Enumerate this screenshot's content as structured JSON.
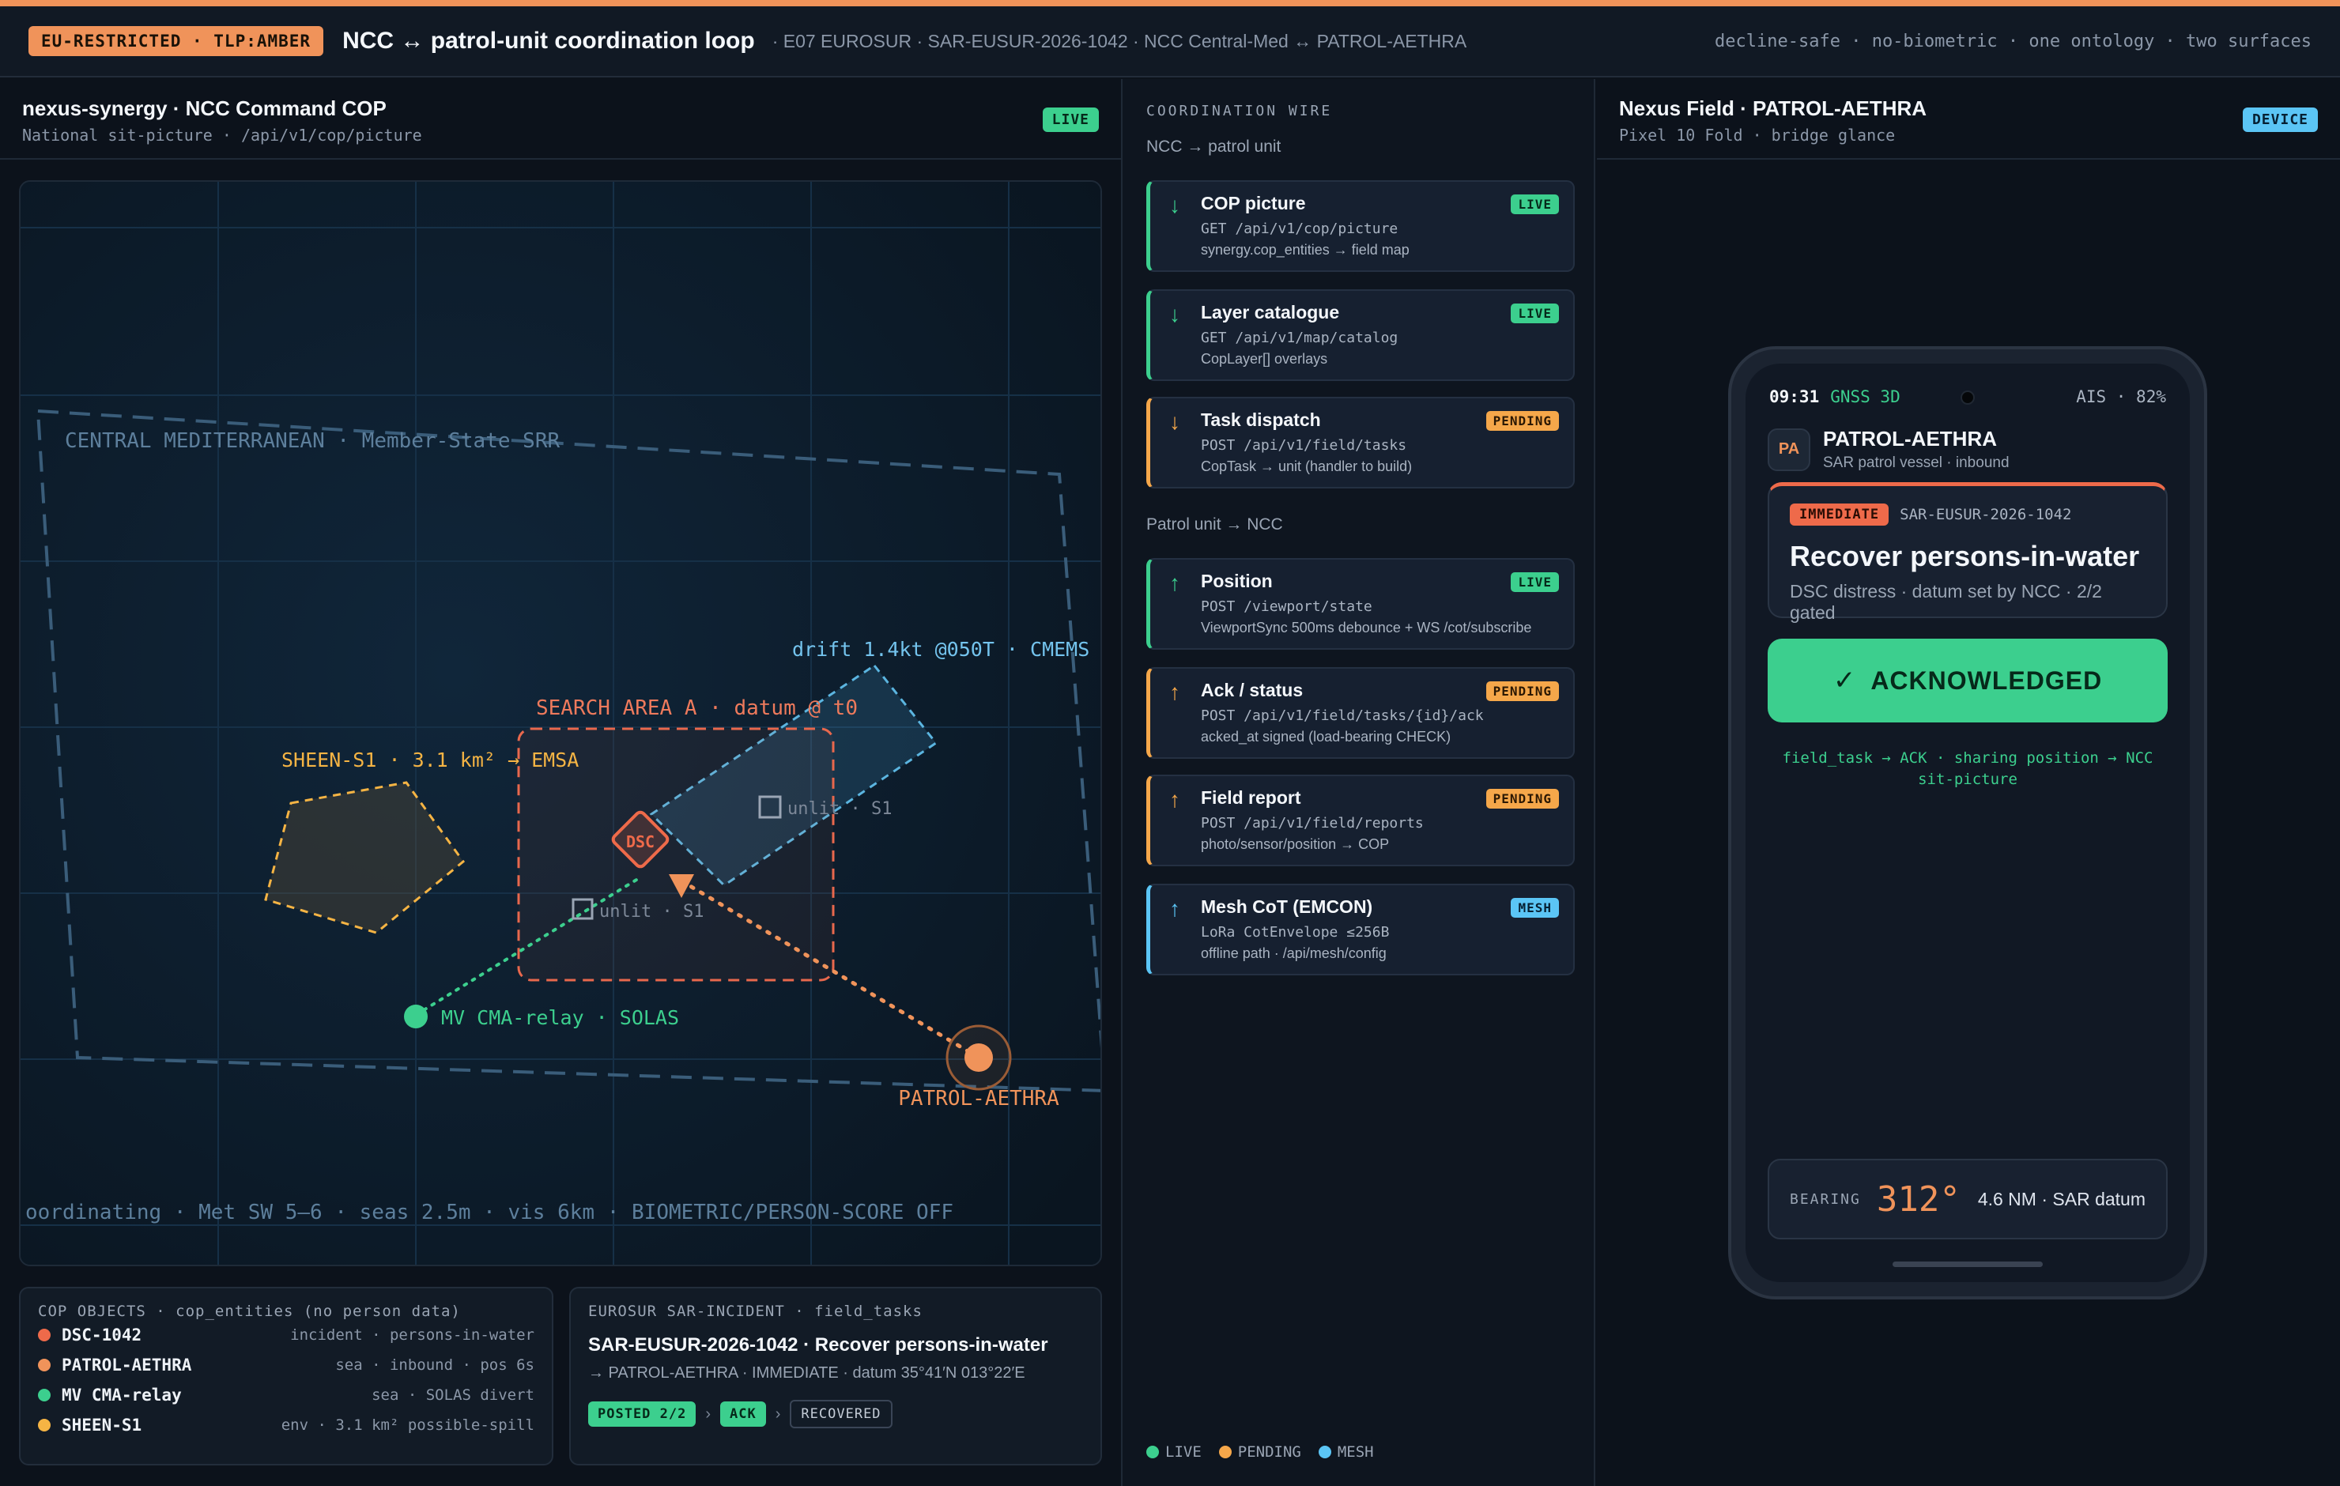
{
  "topbar": {
    "classification": "EU-RESTRICTED · TLP:AMBER",
    "title": "NCC ↔ patrol-unit coordination loop",
    "subtitle": "· E07 EUROSUR · SAR-EUSUR-2026-1042 · NCC Central-Med ↔ PATROL-AETHRA",
    "tags": "decline-safe · no-biometric · one ontology · two surfaces"
  },
  "cop": {
    "title": "nexus-synergy · NCC Command COP",
    "subtitle": "National sit-picture · /api/v1/cop/picture",
    "badge": "LIVE",
    "map": {
      "region_label": "CENTRAL MEDITERRANEAN · Member-State SRR",
      "drift_label": "drift 1.4kt @050T · CMEMS leeway",
      "search_label": "SEARCH AREA A · datum @ t0",
      "sheen_label": "SHEEN-S1 · 3.1 km² → EMSA",
      "dsc_label": "DSC",
      "unlit_1": "unlit · S1",
      "unlit_2": "unlit · S1",
      "relay_label": "MV CMA-relay · SOLAS",
      "patrol_label": "PATROL-AETHRA",
      "footer": "oordinating · Met SW 5–6 · seas 2.5m · vis 6km · BIOMETRIC/PERSON-SCORE OFF"
    }
  },
  "objects": {
    "header": "COP OBJECTS · cop_entities (no person data)",
    "items": [
      {
        "name": "DSC-1042",
        "meta": "incident · persons-in-water",
        "color": "#ee6a4a"
      },
      {
        "name": "PATROL-AETHRA",
        "meta": "sea · inbound · pos 6s",
        "color": "#f0935a"
      },
      {
        "name": "MV CMA-relay",
        "meta": "sea · SOLAS divert",
        "color": "#3ccf8e"
      },
      {
        "name": "SHEEN-S1",
        "meta": "env · 3.1 km² possible-spill",
        "color": "#f5b444"
      }
    ]
  },
  "incident": {
    "header": "EUROSUR SAR-INCIDENT · field_tasks",
    "title": "SAR-EUSUR-2026-1042 · Recover persons-in-water",
    "desc": "→ PATROL-AETHRA · IMMEDIATE · datum 35°41′N 013°22′E",
    "steps": [
      "POSTED 2/2",
      "ACK",
      "RECOVERED"
    ],
    "step_arrow": "›"
  },
  "wire": {
    "title": "COORDINATION WIRE",
    "group_down": "NCC → patrol unit",
    "group_up": "Patrol unit → NCC",
    "arrow_down": "↓",
    "arrow_up": "↑",
    "cards": [
      {
        "name": "COP picture",
        "endpoint": "GET /api/v1/cop/picture",
        "desc": "synergy.cop_entities → field map",
        "status": "LIVE"
      },
      {
        "name": "Layer catalogue",
        "endpoint": "GET /api/v1/map/catalog",
        "desc": "CopLayer[] overlays",
        "status": "LIVE"
      },
      {
        "name": "Task dispatch",
        "endpoint": "POST /api/v1/field/tasks",
        "desc": "CopTask → unit (handler to build)",
        "status": "PENDING"
      },
      {
        "name": "Position",
        "endpoint": "POST /viewport/state",
        "desc": "ViewportSync 500ms debounce + WS /cot/subscribe",
        "status": "LIVE"
      },
      {
        "name": "Ack / status",
        "endpoint": "POST /api/v1/field/tasks/{id}/ack",
        "desc": "acked_at signed (load-bearing CHECK)",
        "status": "PENDING"
      },
      {
        "name": "Field report",
        "endpoint": "POST /api/v1/field/reports",
        "desc": "photo/sensor/position → COP",
        "status": "PENDING"
      },
      {
        "name": "Mesh CoT (EMCON)",
        "endpoint": "LoRa CotEnvelope ≤256B",
        "desc": "offline path · /api/mesh/config",
        "status": "MESH"
      }
    ],
    "legend": [
      "LIVE",
      "PENDING",
      "MESH"
    ]
  },
  "device": {
    "title": "Nexus Field · PATROL-AETHRA",
    "subtitle": "Pixel 10 Fold · bridge glance",
    "badge": "DEVICE",
    "status_time": "09:31",
    "status_gnss": "GNSS 3D",
    "status_right": "AIS · 82%",
    "avatar": "PA",
    "vessel_name": "PATROL-AETHRA",
    "vessel_sub": "SAR patrol vessel · inbound",
    "priority": "IMMEDIATE",
    "incident_id": "SAR-EUSUR-2026-1042",
    "task_title": "Recover persons-in-water",
    "task_sub": "DSC distress · datum set by NCC · 2/2 gated",
    "ack_label": "ACKNOWLEDGED",
    "ack_icon": "✓",
    "ack_note": "field_task → ACK · sharing position → NCC sit-picture",
    "bearing_label": "BEARING",
    "bearing_value": "312°",
    "bearing_dist": "4.6 NM · SAR datum"
  },
  "colors": {
    "accent": "#f0935a",
    "live": "#3ccf8e",
    "pending": "#f5a74a",
    "mesh": "#5bc5f5",
    "alert": "#ee6a4a"
  }
}
